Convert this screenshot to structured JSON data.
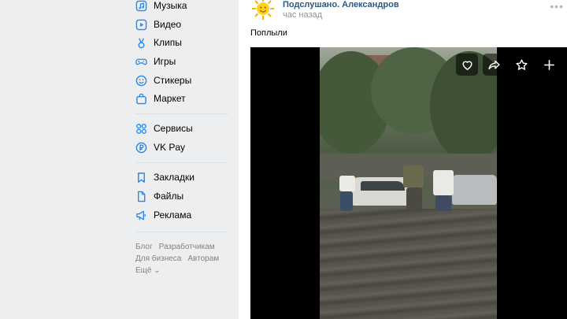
{
  "sidebar": {
    "items": [
      {
        "label": "Музыка",
        "icon": "music-icon"
      },
      {
        "label": "Видео",
        "icon": "video-icon"
      },
      {
        "label": "Клипы",
        "icon": "clips-icon"
      },
      {
        "label": "Игры",
        "icon": "gamepad-icon"
      },
      {
        "label": "Стикеры",
        "icon": "sticker-icon"
      },
      {
        "label": "Маркет",
        "icon": "shopping-bag-icon"
      },
      {
        "label": "Сервисы",
        "icon": "grid-icon"
      },
      {
        "label": "VK Pay",
        "icon": "ruble-icon"
      },
      {
        "label": "Закладки",
        "icon": "bookmark-icon"
      },
      {
        "label": "Файлы",
        "icon": "file-icon"
      },
      {
        "label": "Реклама",
        "icon": "megaphone-icon"
      }
    ],
    "footer": {
      "blog": "Блог",
      "developers": "Разработчикам",
      "business": "Для бизнеса",
      "authors": "Авторам",
      "more": "Ещё ⌄"
    }
  },
  "post": {
    "author": "Подслушано. Александров",
    "time": "час назад",
    "more": "•••",
    "text": "Поплыли"
  },
  "colors": {
    "link": "#2a5885",
    "accent": "#2688eb",
    "background": "#edeef0"
  }
}
